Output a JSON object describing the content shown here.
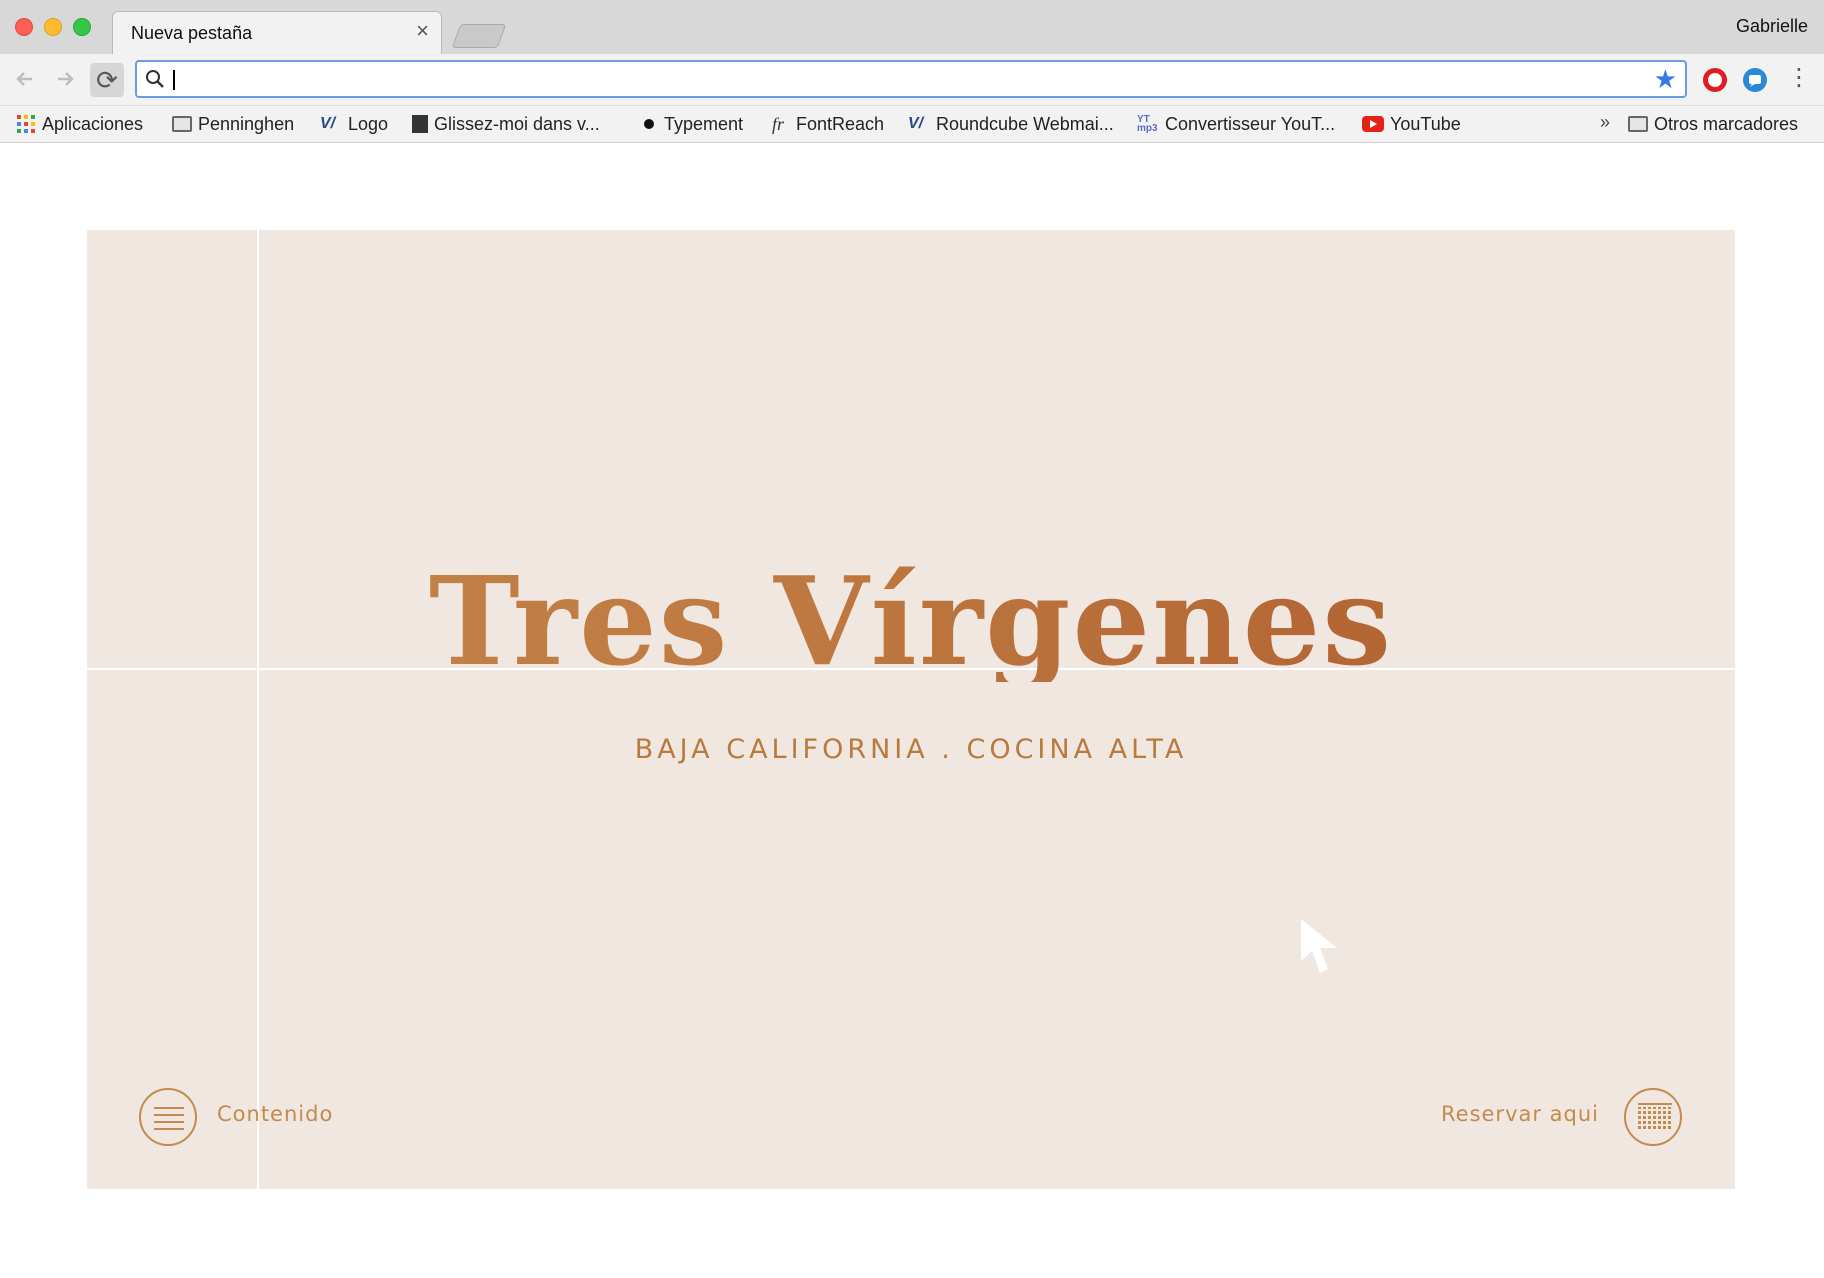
{
  "window": {
    "tab_title": "Nueva pestaña",
    "tab_close": "×",
    "profile_name": "Gabrielle"
  },
  "toolbar": {
    "back_icon": "arrow-left-icon",
    "forward_icon": "arrow-right-icon",
    "reload_glyph": "⟳",
    "address_value": "",
    "bookmark_star": "★",
    "menu_glyph": "⋮"
  },
  "bookmarks": {
    "items": [
      {
        "label": "Aplicaciones",
        "icon": "apps-grid-icon"
      },
      {
        "label": "Penninghen",
        "icon": "folder-icon"
      },
      {
        "label": "Logo",
        "icon": "v-logo-icon"
      },
      {
        "label": "Glissez-moi dans v...",
        "icon": "bookmarklet-icon"
      },
      {
        "label": "Typement",
        "icon": "dot-icon"
      },
      {
        "label": "FontReach",
        "icon": "fr-icon"
      },
      {
        "label": "Roundcube Webmai...",
        "icon": "v-logo-icon"
      },
      {
        "label": "Convertisseur YouT...",
        "icon": "yt-mp3-icon"
      },
      {
        "label": "YouTube",
        "icon": "youtube-icon"
      }
    ],
    "overflow": "»",
    "other_label": "Otros marcadores"
  },
  "page": {
    "brand": "Tres Vírgenes",
    "tagline": "BAJA CALIFORNIA . COCINA ALTA",
    "menu_label": "Contenido",
    "reserve_label": "Reservar aqui",
    "colors": {
      "background": "#efe7e0",
      "accent": "#c48a4e",
      "brand_copper": "#b86e36"
    }
  }
}
